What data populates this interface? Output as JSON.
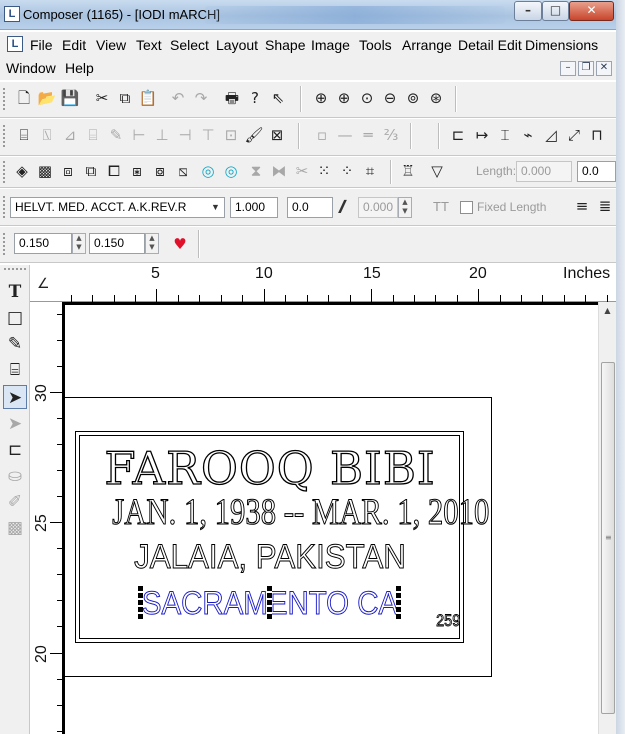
{
  "window": {
    "title": "Composer (1165) - [IODI mARCH]",
    "app_icon": "L",
    "min_glyph": "–",
    "max_glyph": "□",
    "close_glyph": "✕"
  },
  "menu": {
    "items": [
      "File",
      "Edit",
      "View",
      "Text",
      "Select",
      "Layout",
      "Shape",
      "Image",
      "Tools",
      "Arrange",
      "Detail Edit",
      "Dimensions",
      "Window",
      "Help"
    ],
    "mdi_min": "–",
    "mdi_restore": "❐",
    "mdi_close": "✕"
  },
  "toolbar_standard": {
    "icons": [
      "new-document-icon",
      "open-folder-icon",
      "save-icon",
      "cut-icon",
      "copy-icon",
      "paste-icon",
      "undo-icon",
      "redo-icon",
      "print-icon",
      "help-icon",
      "context-help-icon",
      "zoom-icon",
      "zoom-in-icon",
      "zoom-area-icon",
      "zoom-out-icon",
      "zoom-fit-icon",
      "zoom-page-icon"
    ]
  },
  "toolbar_fields": {
    "length_label": "Length:",
    "length_value": "0.000",
    "offset_value": "0.0"
  },
  "text_toolbar": {
    "font_name": "HELVT. MED. ACCT. A.K.REV.R",
    "font_dropdown_glyph": "▼",
    "scale_value": "1.000",
    "angle_value": "0.0",
    "italic_glyph": "𝑰",
    "slant_value": "0.000",
    "fixed_length_label": "Fixed Length",
    "fit_glyph": "ТТ"
  },
  "dimensions_toolbar": {
    "width_value": "0.150",
    "height_value": "0.150",
    "heart_icon_color": "#e0102a"
  },
  "ruler": {
    "horizontal_numbers": [
      "5",
      "10",
      "15",
      "20"
    ],
    "units_label": "Inches",
    "vertical_numbers": [
      "30",
      "25",
      "20"
    ],
    "corner_glyph": "∠"
  },
  "design": {
    "line1": "FAROOQ   BIBI",
    "line2": "JAN. 1, 1938  --  MAR. 1, 2010",
    "line3": "JALAIA,  PAKISTAN",
    "line4": "SACRAMENTO  CA",
    "code_number": "259",
    "line4_color": "#1a1ac8"
  },
  "scrollbar": {
    "up_glyph": "▲",
    "grip_glyph": "≡"
  }
}
